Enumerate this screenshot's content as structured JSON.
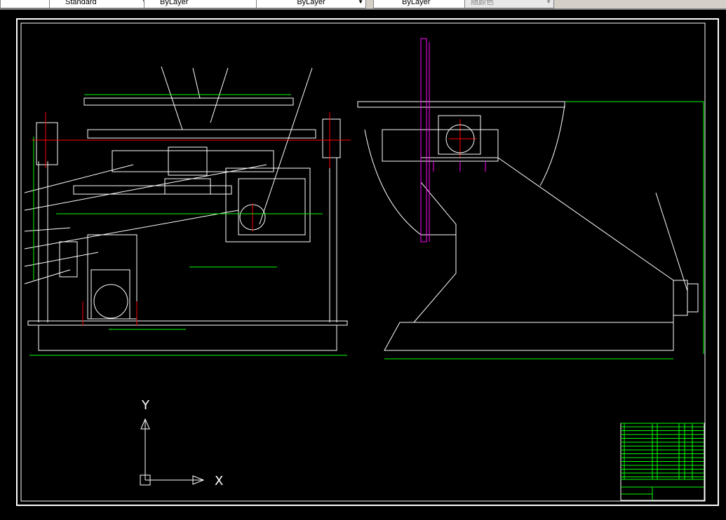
{
  "toolbar": {
    "text_style": "Standard",
    "layer": "ByLayer",
    "linetype": "ByLayer",
    "lineweight": "ByLayer",
    "plot_style": "随颜色"
  },
  "drawing": {
    "axis_y": "Y",
    "axis_x": "X",
    "colors": {
      "background": "#000000",
      "lines": "#ffffff",
      "dimensions": "#00ff00",
      "centerlines": "#ff0000",
      "highlight": "#ff00ff",
      "accent": "#00ffff"
    }
  }
}
